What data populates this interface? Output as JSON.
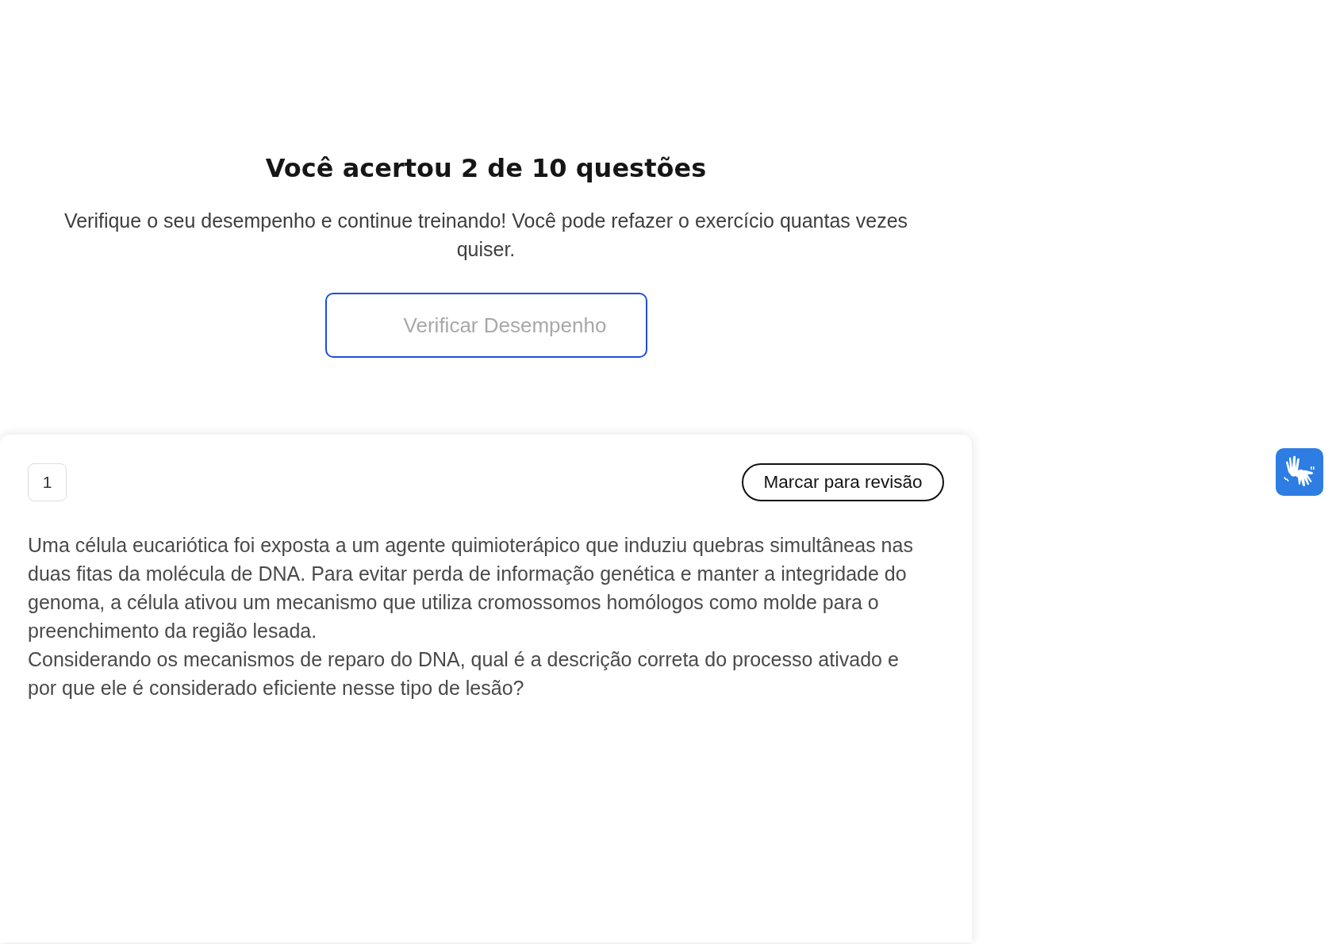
{
  "result": {
    "title": "Você acertou 2 de 10 questões",
    "message": "Verifique o seu desempenho e continue treinando! Você pode refazer o exercício quantas vezes quiser.",
    "button": "Verificar Desempenho"
  },
  "question": {
    "number": "1",
    "review_button": "Marcar para revisão",
    "paragraphs": [
      "Uma célula eucariótica foi exposta a um agente quimioterápico que induziu quebras simultâneas nas duas fitas da molécula de DNA. Para evitar perda de informação genética e manter a integridade do genoma, a célula ativou um mecanismo que utiliza cromossomos homólogos como molde para o preenchimento da região lesada.",
      "Considerando os mecanismos de reparo do DNA, qual é a descrição correta do processo ativado e por que ele é considerado eficiente nesse tipo de lesão?"
    ]
  }
}
